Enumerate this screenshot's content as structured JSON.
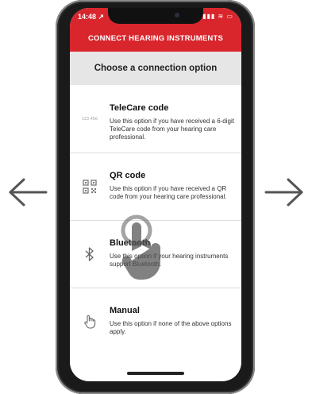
{
  "status_bar": {
    "time": "14:48 ↗",
    "icons": "▮▮▮ ≋ ▭"
  },
  "header": {
    "title": "CONNECT HEARING INSTRUMENTS"
  },
  "subheader": {
    "title": "Choose a connection option"
  },
  "options": [
    {
      "title": "TeleCare code",
      "description": "Use this option if you have received a 6-digit TeleCare code from your hearing care professional.",
      "icon": "numeric-code-icon",
      "icon_text": "123 456"
    },
    {
      "title": "QR code",
      "description": "Use this option if you have received a QR code from your hearing care professional.",
      "icon": "qr-code-icon"
    },
    {
      "title": "Bluetooth",
      "description": "Use this option if your hearing instruments support Bluetooth.",
      "icon": "bluetooth-icon"
    },
    {
      "title": "Manual",
      "description": "Use this option if none of the above options apply.",
      "icon": "hand-pointer-icon"
    }
  ],
  "colors": {
    "brand_red": "#d9262d",
    "subheader_bg": "#e6e6e6",
    "arrow_gray": "#555555"
  }
}
